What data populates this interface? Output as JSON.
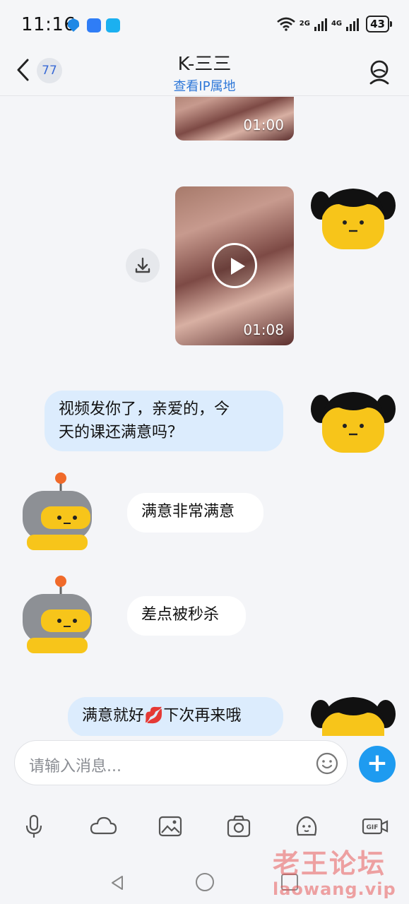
{
  "status_bar": {
    "time": "11:16",
    "network_1": "2G",
    "network_2": "4G",
    "battery": "43"
  },
  "header": {
    "unread_count": "77",
    "contact_name": "K-三三",
    "subtitle": "查看IP属地"
  },
  "messages": [
    {
      "type": "video",
      "sender": "me",
      "duration": "01:00"
    },
    {
      "type": "video",
      "sender": "me",
      "duration": "01:08"
    },
    {
      "type": "text",
      "sender": "me",
      "text_line1": "视频发你了，亲爱的，今",
      "text_line2": "天的课还满意吗？"
    },
    {
      "type": "text",
      "sender": "them",
      "text": "满意非常满意"
    },
    {
      "type": "text",
      "sender": "them",
      "text": "差点被秒杀"
    },
    {
      "type": "text",
      "sender": "me",
      "text_before": "满意就好",
      "emoji": "💋",
      "text_after": "下次再来哦"
    }
  ],
  "input": {
    "placeholder": "请输入消息..."
  },
  "toolbar": {
    "icons": [
      "microphone-icon",
      "cloud-icon",
      "image-icon",
      "camera-icon",
      "emoji-icon",
      "gif-icon"
    ],
    "gif_label": "GIF"
  },
  "watermark": {
    "line1": "老王论坛",
    "line2": "laowang.vip"
  },
  "colors": {
    "accent": "#1e9bf0",
    "my_bubble": "#dcecfd",
    "their_bubble": "#ffffff",
    "link": "#2f78d8"
  }
}
